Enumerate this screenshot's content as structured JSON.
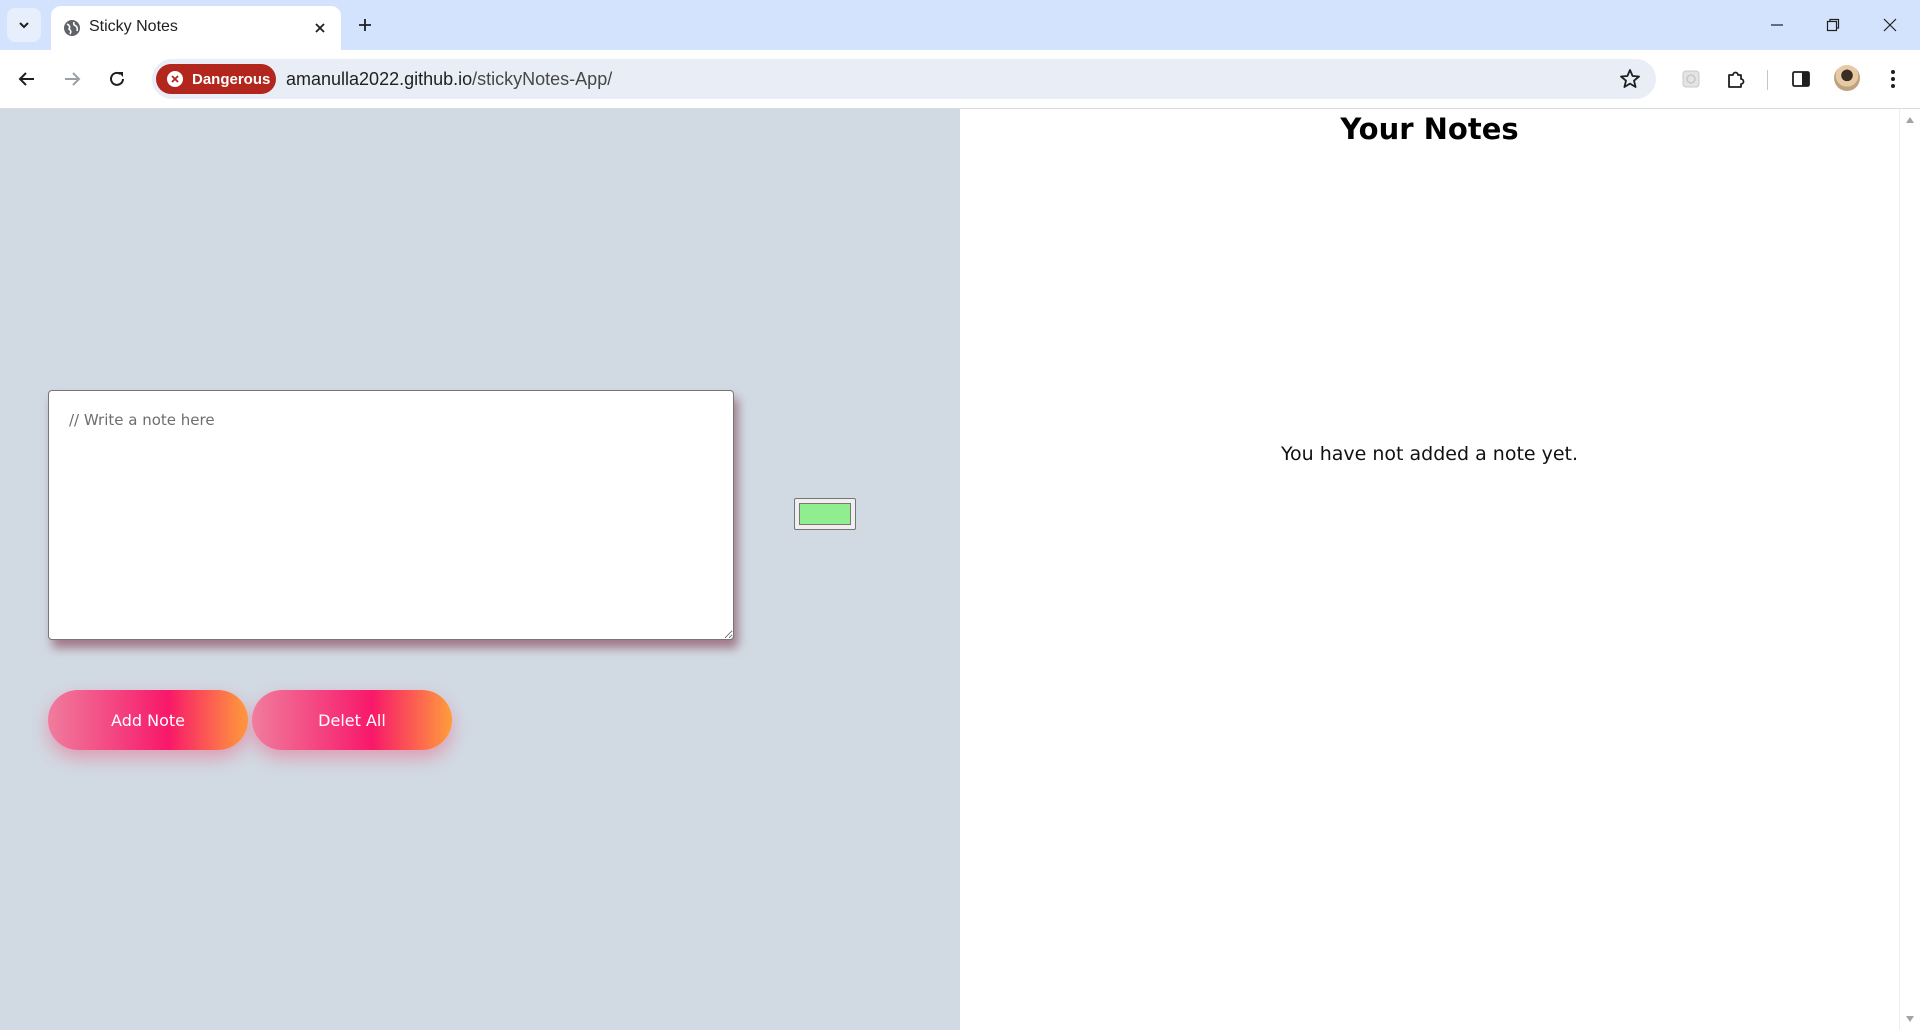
{
  "browser": {
    "tab_title": "Sticky Notes",
    "security_label": "Dangerous",
    "url_host": "amanulla2022.github.io",
    "url_path": "/stickyNotes-App/"
  },
  "editor": {
    "placeholder": "// Write a note here",
    "value": "",
    "color": "#90ee90",
    "add_label": "Add Note",
    "delete_label": "Delet All"
  },
  "notes": {
    "title": "Your Notes",
    "empty_message": "You have not added a note yet."
  },
  "colors": {
    "left_background": "#d1dae3",
    "button_gradient_start": "#f07c9d",
    "button_gradient_end": "#ff9d3b",
    "danger_chip": "#b3261e"
  }
}
